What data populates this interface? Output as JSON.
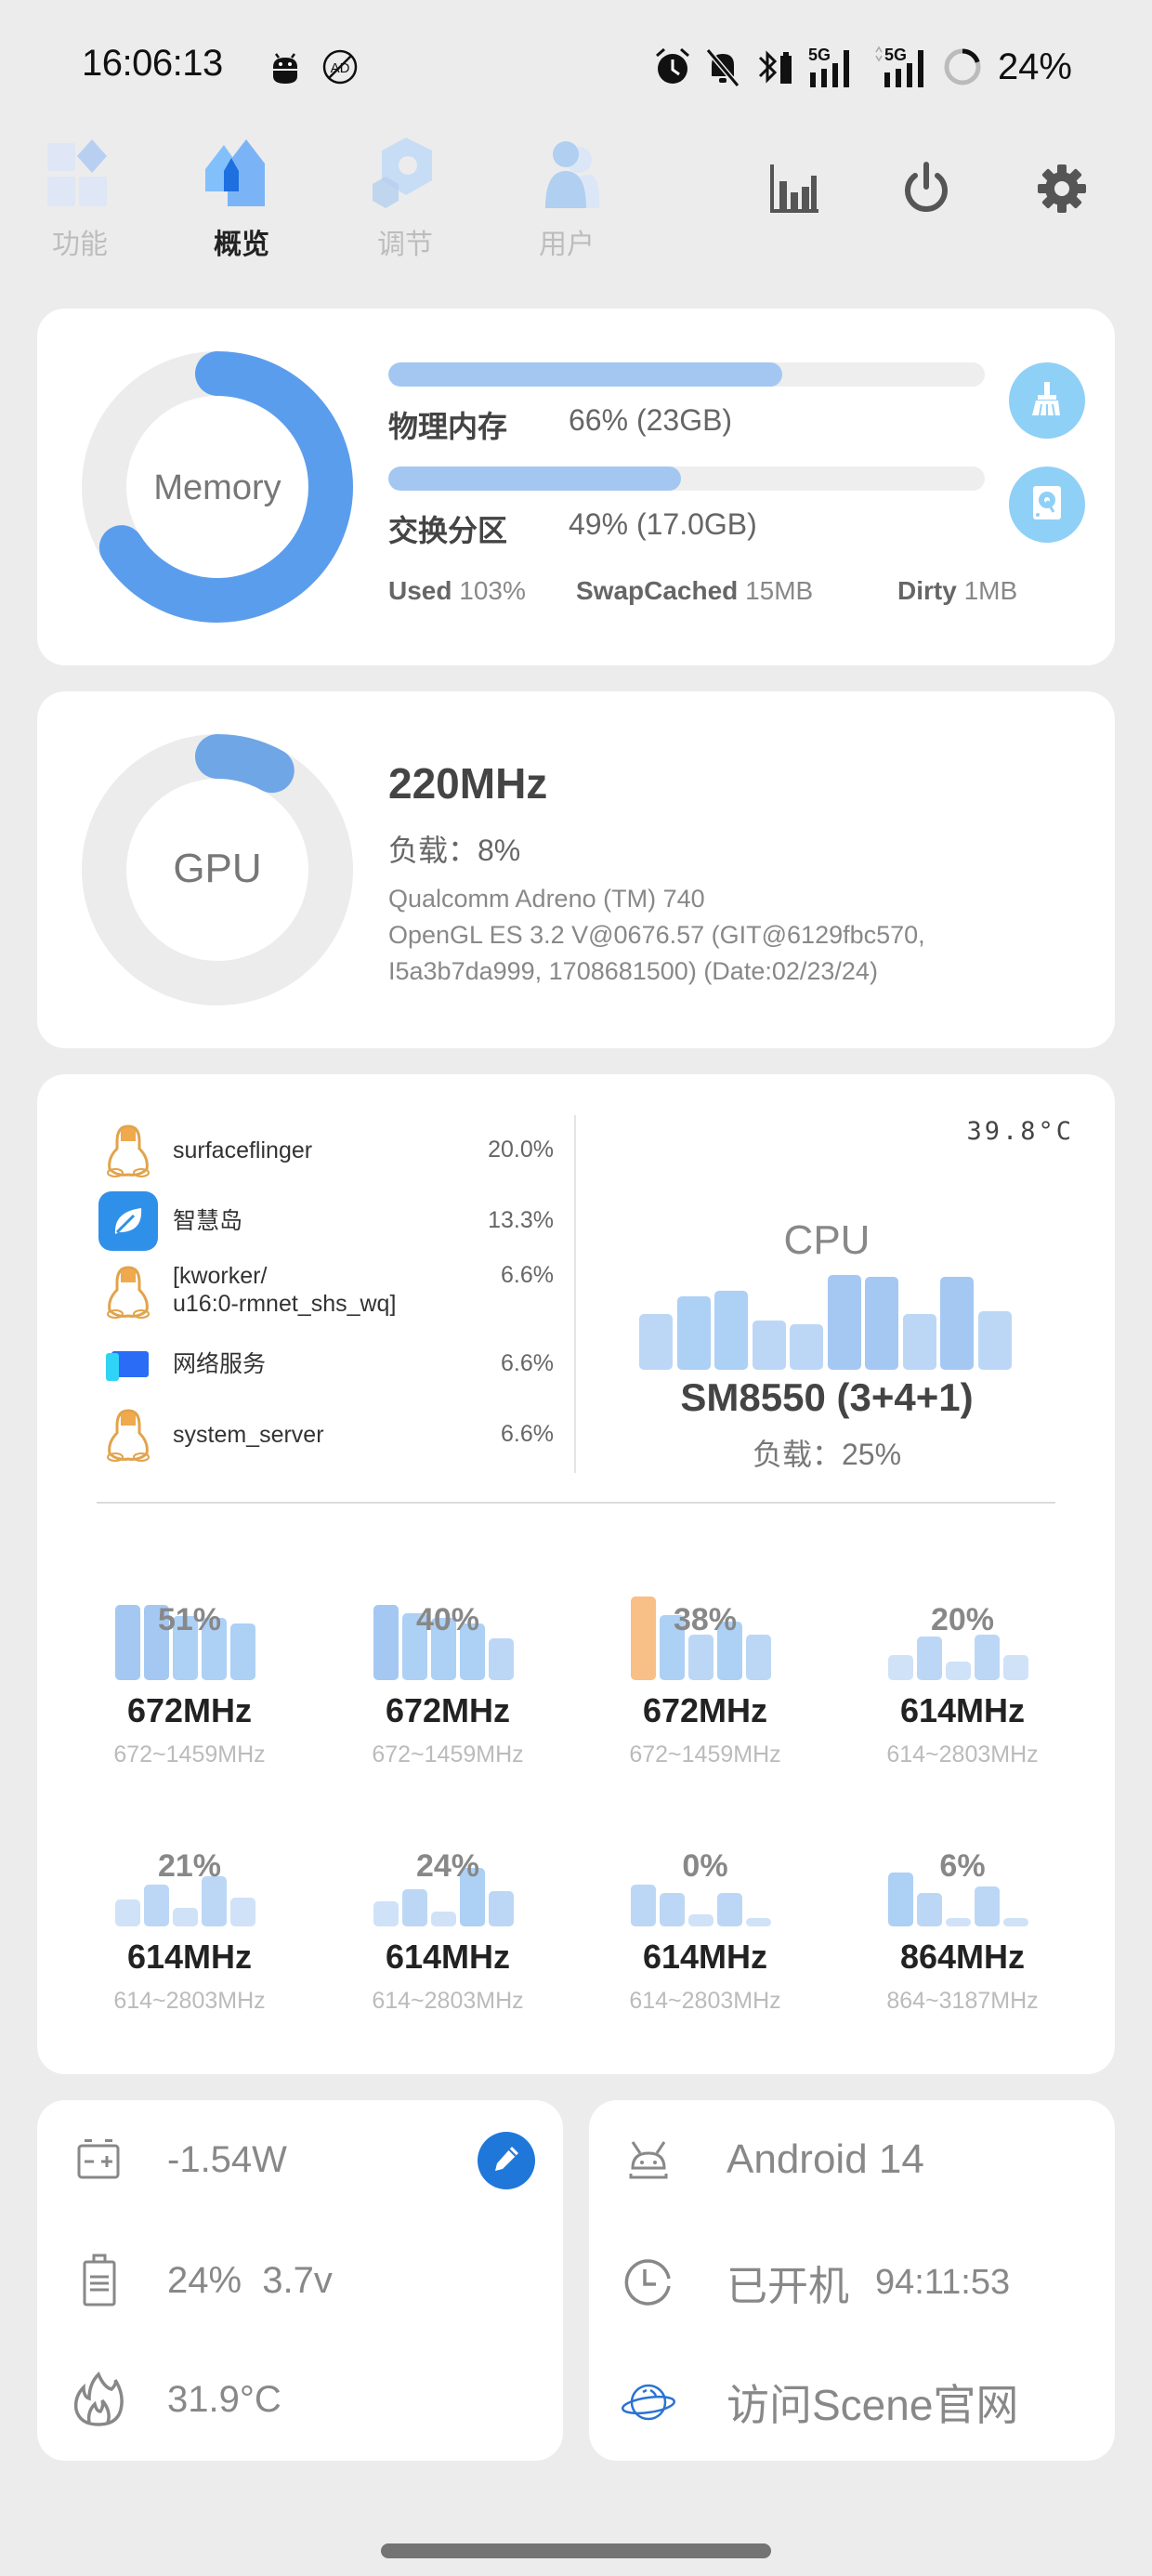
{
  "status_bar": {
    "time": "16:06:13",
    "left_icons": [
      "android-debug-icon",
      "ad-block-icon"
    ],
    "right_icons": [
      "alarm-icon",
      "mute-bell-icon",
      "bluetooth-battery-icon",
      "5g-signal-icon",
      "5g-signal-icon"
    ],
    "signal_label_1": "5G",
    "signal_label_2": "5G",
    "battery_percent": "24%",
    "battery_level": 0.24
  },
  "nav": {
    "tabs": [
      {
        "label": "功能",
        "icon": "feature-blocks-icon",
        "active": false
      },
      {
        "label": "概览",
        "icon": "home-icon",
        "active": true
      },
      {
        "label": "调节",
        "icon": "tune-hexagon-icon",
        "active": false
      },
      {
        "label": "用户",
        "icon": "user-icon",
        "active": false
      }
    ],
    "actions": [
      "chart-icon",
      "power-icon",
      "settings-icon"
    ]
  },
  "memory": {
    "donut_label": "Memory",
    "donut_used_fraction": 0.66,
    "physical": {
      "label": "物理内存",
      "value": "66% (23GB)",
      "fill": 0.66
    },
    "swap": {
      "label": "交换分区",
      "value": "49% (17.0GB)",
      "fill": 0.49
    },
    "stats": [
      {
        "key": "Used",
        "value": "103%"
      },
      {
        "key": "SwapCached",
        "value": "15MB"
      },
      {
        "key": "Dirty",
        "value": "1MB"
      }
    ],
    "clean_button_icon": "broom-icon",
    "swap_button_icon": "hard-disk-icon"
  },
  "gpu": {
    "donut_label": "GPU",
    "load_fraction": 0.08,
    "frequency": "220MHz",
    "load": "负载：8%",
    "info_lines": [
      "Qualcomm Adreno (TM) 740",
      "OpenGL ES 3.2 V@0676.57 (GIT@6129fbc570,",
      "I5a3b7da999, 1708681500) (Date:02/23/24)"
    ]
  },
  "processes": [
    {
      "name": "surfaceflinger",
      "percent": "20.0%",
      "icon": "linux-penguin-icon"
    },
    {
      "name": "智慧岛",
      "percent": "13.3%",
      "icon": "leaf-app-icon"
    },
    {
      "name": "[kworker/\nu16:0-rmnet_shs_wq]",
      "percent": "6.6%",
      "icon": "linux-penguin-icon"
    },
    {
      "name": "网络服务",
      "percent": "6.6%",
      "icon": "network-service-icon"
    },
    {
      "name": "system_server",
      "percent": "6.6%",
      "icon": "linux-penguin-icon"
    }
  ],
  "cpu": {
    "temperature": "39.8°C",
    "label": "CPU",
    "model": "SM8550 (3+4+1)",
    "load": "负载：25%",
    "history": [
      0.55,
      0.72,
      0.77,
      0.48,
      0.45,
      0.93,
      0.91,
      0.55,
      0.91,
      0.57
    ],
    "cores": [
      {
        "percent": "51%",
        "freq": "672MHz",
        "range": "672~1459MHz",
        "history": [
          0.9,
          0.9,
          0.77,
          0.75,
          0.68
        ],
        "hot_first": false
      },
      {
        "percent": "40%",
        "freq": "672MHz",
        "range": "672~1459MHz",
        "history": [
          0.9,
          0.8,
          0.75,
          0.68,
          0.5
        ],
        "hot_first": false
      },
      {
        "percent": "38%",
        "freq": "672MHz",
        "range": "672~1459MHz",
        "history": [
          1.0,
          0.78,
          0.55,
          0.7,
          0.55
        ],
        "hot_first": true
      },
      {
        "percent": "20%",
        "freq": "614MHz",
        "range": "614~2803MHz",
        "history": [
          0.3,
          0.52,
          0.22,
          0.55,
          0.3
        ],
        "hot_first": false
      },
      {
        "percent": "21%",
        "freq": "614MHz",
        "range": "614~2803MHz",
        "history": [
          0.32,
          0.5,
          0.22,
          0.6,
          0.35
        ],
        "hot_first": false
      },
      {
        "percent": "24%",
        "freq": "614MHz",
        "range": "614~2803MHz",
        "history": [
          0.3,
          0.45,
          0.18,
          0.7,
          0.42
        ],
        "hot_first": false
      },
      {
        "percent": "0%",
        "freq": "614MHz",
        "range": "614~2803MHz",
        "history": [
          0.5,
          0.4,
          0.14,
          0.4,
          0.1
        ],
        "hot_first": false
      },
      {
        "percent": "6%",
        "freq": "864MHz",
        "range": "864~3187MHz",
        "history": [
          0.65,
          0.4,
          0.1,
          0.48,
          0.1
        ],
        "hot_first": false
      }
    ]
  },
  "battery": {
    "power": "-1.54W",
    "level_voltage": "24%  3.7v",
    "temperature": "31.9°C",
    "edit_icon": "pencil-icon"
  },
  "system": {
    "android": "Android 14",
    "uptime_label": "已开机",
    "uptime": "94:11:53",
    "website": "访问Scene官网"
  },
  "colors": {
    "accent": "#5b9ded",
    "bar_fill": "#a3c7f1",
    "round_button": "#8fd0f7",
    "edit_button": "#1f78d9",
    "hot_core": "#f8bf87"
  }
}
